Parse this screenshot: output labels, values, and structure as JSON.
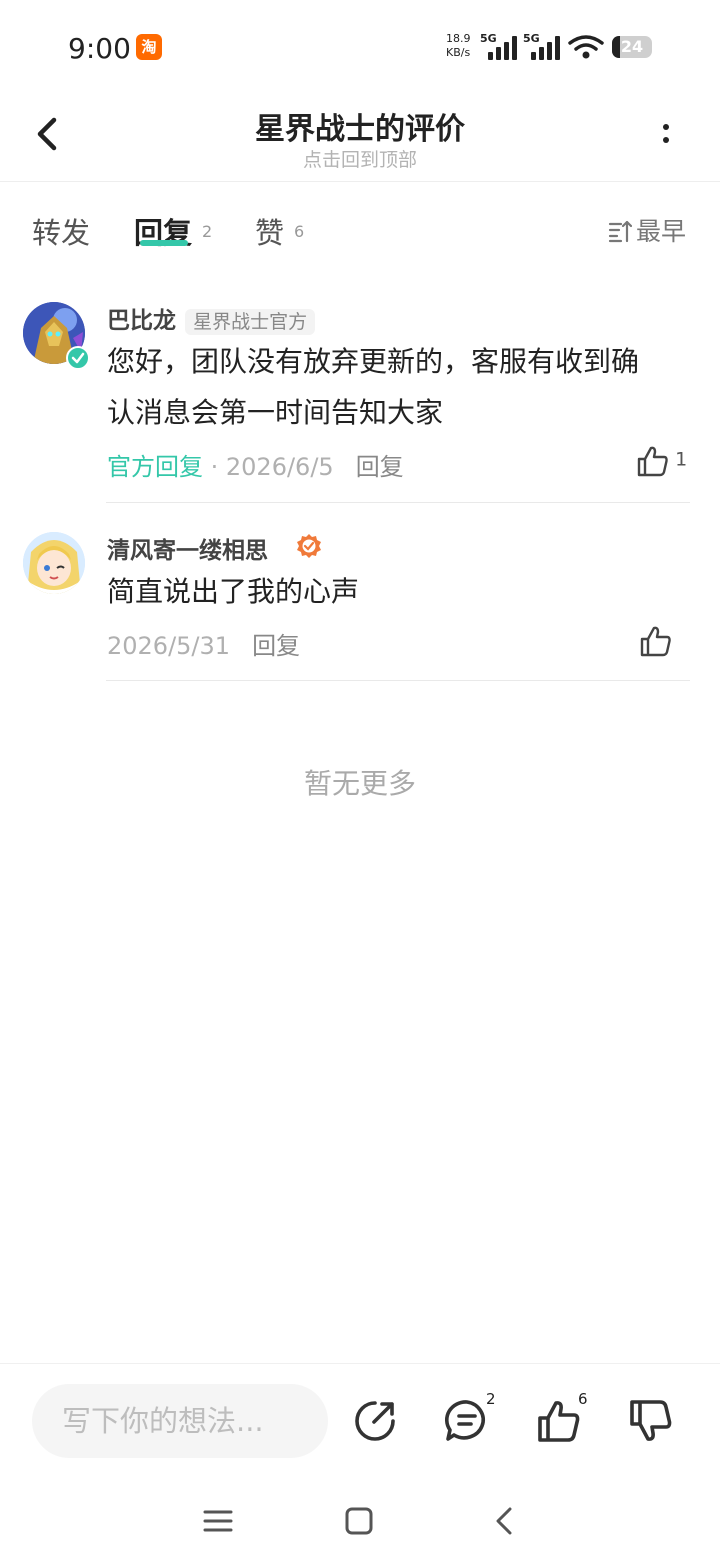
{
  "status_bar": {
    "time": "9:00",
    "app_icon": "淘",
    "net_speed_value": "18.9",
    "net_speed_unit": "KB/s",
    "signal_label_1": "5G",
    "signal_label_2": "5G",
    "battery": "24"
  },
  "header": {
    "title": "星界战士的评价",
    "subtitle": "点击回到顶部"
  },
  "tabs": [
    {
      "label": "转发",
      "count": ""
    },
    {
      "label": "回复",
      "count": "2"
    },
    {
      "label": "赞",
      "count": "6"
    }
  ],
  "sort_label": "最早",
  "comments": [
    {
      "name": "巴比龙",
      "tag": "星界战士官方",
      "text_line1": "您好，团队没有放弃更新的，客服有收到确",
      "text_line2": "认消息会第一时间告知大家",
      "official_label": "官方回复",
      "separator": " · ",
      "date": "2026/6/5",
      "reply_label": "回复",
      "likes": "1"
    },
    {
      "name": "清风寄一缕相思",
      "text": "简直说出了我的心声",
      "date": "2026/5/31",
      "reply_label": "回复"
    }
  ],
  "no_more": "暂无更多",
  "bottom_bar": {
    "input_placeholder": "写下你的想法...",
    "comment_count": "2",
    "like_count": "6"
  },
  "colors": {
    "accent": "#34c7a9",
    "level_badge": "#f07a3a"
  }
}
